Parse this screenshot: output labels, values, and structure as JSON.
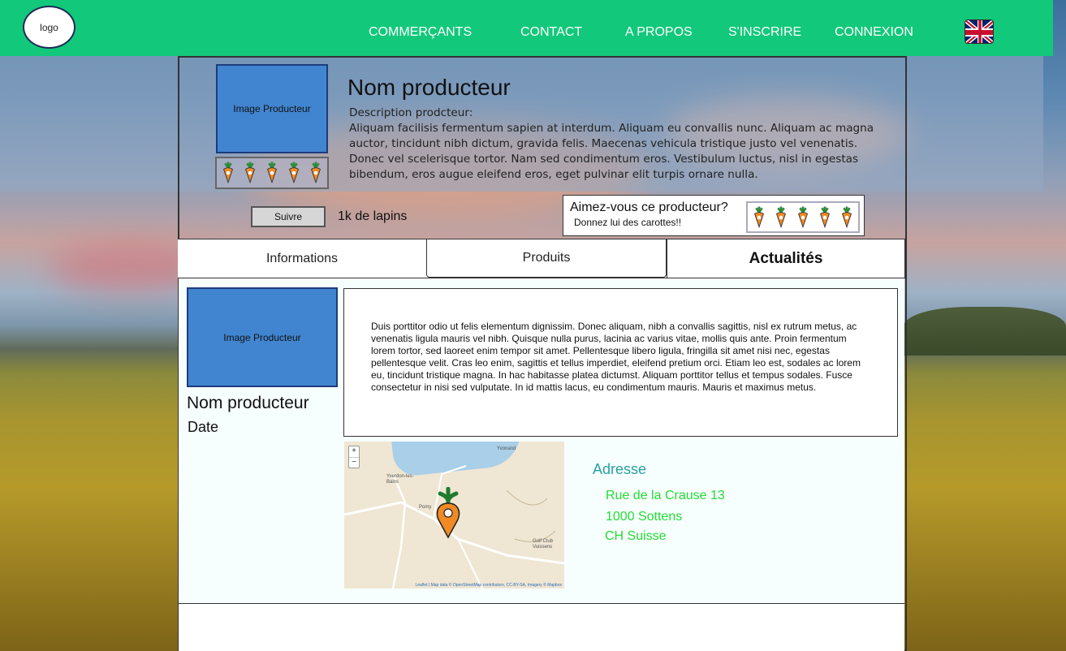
{
  "header": {
    "logo": "logo",
    "nav": [
      "COMMERÇANTS",
      "CONTACT",
      "A PROPOS",
      "S'INSCRIRE",
      "CONNEXION"
    ],
    "language_icon": "uk-flag-icon"
  },
  "producer": {
    "image_label": "Image Producteur",
    "name": "Nom producteur",
    "description_label": "Description prodcteur:",
    "description": "Aliquam facilisis fermentum sapien at interdum. Aliquam eu convallis nunc. Aliquam ac magna auctor, tincidunt nibh dictum, gravida felis. Maecenas vehicula tristique justo vel venenatis. Donec vel scelerisque tortor. Nam sed condimentum eros. Vestibulum luctus, nisl in egestas bibendum, eros augue eleifend eros, eget pulvinar elit turpis ornare nulla.",
    "rating_carrots": 5,
    "follow_label": "Suivre",
    "followers": "1k de lapins"
  },
  "rate_box": {
    "title": "Aimez-vous ce producteur?",
    "subtitle": "Donnez lui des carottes!!",
    "carrots": 5
  },
  "tabs": [
    {
      "label": "Informations",
      "active": false
    },
    {
      "label": "Produits",
      "active": false
    },
    {
      "label": "Actualités",
      "active": true
    }
  ],
  "news": {
    "image_label": "Image Producteur",
    "producer_name": "Nom producteur",
    "date_label": "Date",
    "text": "Duis porttitor odio ut felis elementum dignissim. Donec aliquam, nibh a convallis sagittis, nisl ex rutrum metus, ac venenatis ligula mauris vel nibh. Quisque nulla purus, lacinia ac varius vitae, mollis quis ante. Proin fermentum lorem tortor, sed laoreet enim tempor sit amet. Pellentesque libero ligula, fringilla sit amet nisi nec, egestas pellentesque velit. Cras leo enim, sagittis et tellus imperdiet, eleifend pretium orci. Etiam leo est, sodales ac lorem eu, tincidunt tristique magna. In hac habitasse platea dictumst. Aliquam porttitor tellus et tempus sodales. Fusce consectetur in nisi sed vulputate. In id mattis lacus, eu condimentum mauris. Mauris et maximus metus."
  },
  "map": {
    "zoom_in": "+",
    "zoom_out": "−",
    "labels": [
      "Yvonand",
      "Yverdon-les-Bains",
      "Pomy",
      "Golf Club Vuissens"
    ],
    "attribution": "Leaflet | Map data © OpenStreetMap contributors, CC-BY-SA, Imagery © Mapbox"
  },
  "address": {
    "heading": "Adresse",
    "street": "Rue de la Crause 13",
    "city": "1000 Sottens",
    "country": "CH Suisse"
  },
  "colors": {
    "header": "#12c87a",
    "image_placeholder": "#4185d0",
    "address_heading": "#2aa0a0",
    "address_text": "#22dd33"
  }
}
